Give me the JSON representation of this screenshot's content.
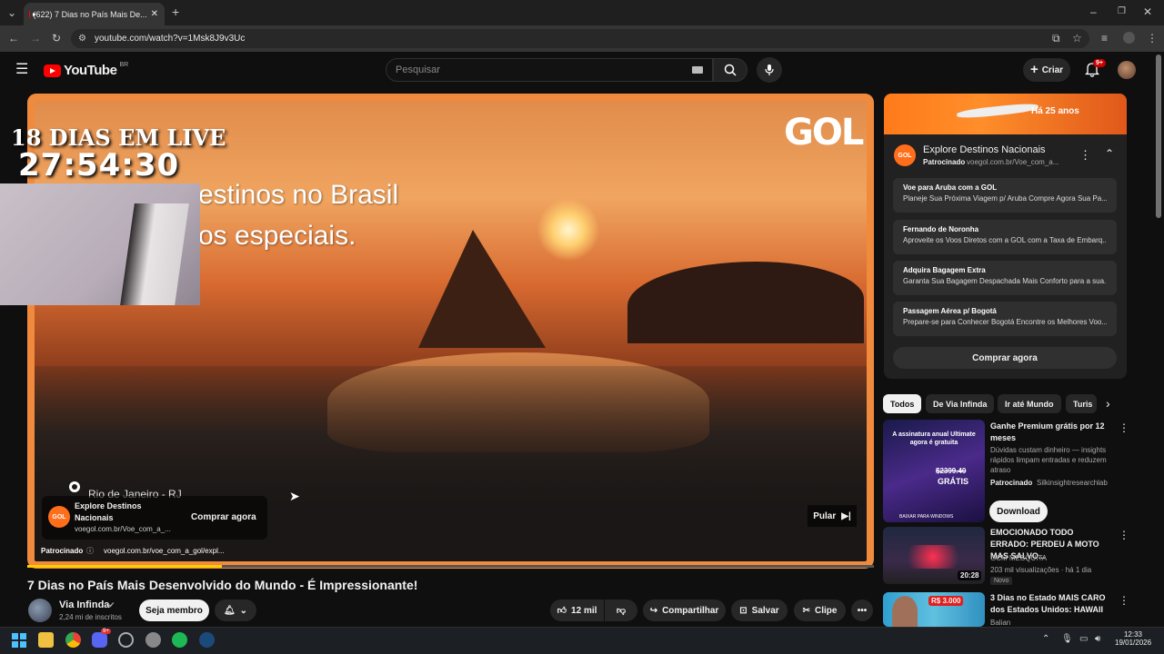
{
  "browser": {
    "tab_title": "(622) 7 Dias no País Mais De...",
    "url": "youtube.com/watch?v=1Msk8J9v3Uc"
  },
  "youtube": {
    "logo_text": "YouTube",
    "region": "BR",
    "search_placeholder": "Pesquisar",
    "create_label": "Criar",
    "notifications_badge": "9+"
  },
  "video": {
    "overlay_live": "18 DIAS EM LIVE",
    "overlay_timer": "27:54:30",
    "text_line1": "estinos no Brasil",
    "text_line2": "os especiais.",
    "brand": "GOL",
    "location": "Rio de Janeiro - RJ",
    "ad_title": "Explore Destinos Nacionais",
    "ad_url": "voegol.com.br/Voe_com_a_...",
    "ad_cta": "Comprar agora",
    "skip_label": "Pular",
    "sponsored_label": "Patrocinado",
    "sponsored_url": "voegol.com.br/voe_com_a_gol/expl...",
    "progress": 0.23,
    "title": "7 Dias no País Mais Desenvolvido do Mundo - É Impressionante!",
    "channel": "Via Infinda",
    "subscribers": "2,24 mi de inscritos",
    "member_button": "Seja membro",
    "likes": "12 mil",
    "share": "Compartilhar",
    "save": "Salvar",
    "clip": "Clipe"
  },
  "ad_panel": {
    "banner_text": "Há 25 anos",
    "title": "Explore Destinos Nacionais",
    "sponsored": "Patrocinado",
    "url": "voegol.com.br/Voe_com_a...",
    "links": [
      {
        "title": "Voe para Aruba com a GOL",
        "desc": "Planeje Sua Próxima Viagem p/ Aruba Compre Agora Sua Pa..."
      },
      {
        "title": "Fernando de Noronha",
        "desc": "Aproveite os Voos Diretos com a GOL com a Taxa de Embarq..."
      },
      {
        "title": "Adquira Bagagem Extra",
        "desc": "Garanta Sua Bagagem Despachada Mais Conforto para a sua..."
      },
      {
        "title": "Passagem Aérea p/ Bogotá",
        "desc": "Prepare-se para Conhecer Bogotá Encontre os Melhores Voo..."
      }
    ],
    "cta": "Comprar agora"
  },
  "chips": [
    "Todos",
    "De Via Infinda",
    "Ir até Mundo",
    "Turis"
  ],
  "sidebar": [
    {
      "title": "Ganhe Premium grátis por 12 meses",
      "desc": "Dúvidas custam dinheiro — insights rápidos limpam entradas e reduzem atraso",
      "sponsor": "Patrocinado",
      "sponsor_name": "Silkinsightresearchlab",
      "button": "Download",
      "thumb_text1": "A assinatura anual Ultimate agora é gratuita",
      "thumb_price": "$2399.40",
      "thumb_free": "GRÁTIS",
      "thumb_footer": "BAIXAR PARA WINDOWS"
    },
    {
      "title": "EMOCIONADO TODO ERRADO: PERDEU A MOTO MAS SALVO...",
      "channel": "GCM MESQUITA",
      "meta": "203 mil visualizações · há 1 dia",
      "badge": "Novo",
      "duration": "20:28"
    },
    {
      "title": "3 Dias no Estado MAIS CARO dos Estados Unidos: HAWAII",
      "channel": "Balian",
      "thumb_price": "R$ 3.000"
    }
  ],
  "taskbar": {
    "time": "12:33",
    "date": "19/01/2026",
    "discord_badge": "9+"
  },
  "colors": {
    "youtube_red": "#ff0000",
    "gol_orange": "#ff6e1a",
    "progress_yellow": "#ffcc00",
    "background": "#0f0f0f"
  }
}
